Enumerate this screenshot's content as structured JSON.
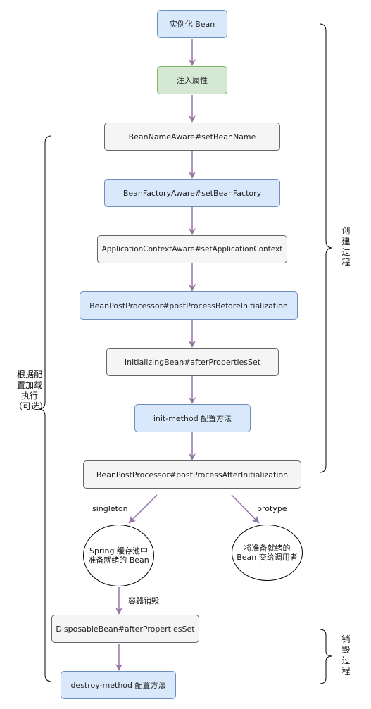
{
  "nodes": {
    "instantiate": "实例化 Bean",
    "inject": "注入属性",
    "bean_name_aware": "BeanNameAware#setBeanName",
    "bean_factory_aware": "BeanFactoryAware#setBeanFactory",
    "app_context_aware": "ApplicationContextAware#setApplicationContext",
    "before_init": "BeanPostProcessor#postProcessBeforeInitialization",
    "initializing_bean": "InitializingBean#afterPropertiesSet",
    "init_method": "init-method 配置方法",
    "after_init": "BeanPostProcessor#postProcessAfterInitialization",
    "singleton_cache": "Spring 缓存池中准备就绪的 Bean",
    "prototype_handoff": "将准备就绪的 Bean 交给调用者",
    "disposable_bean": "DisposableBean#afterPropertiesSet",
    "destroy_method": "destroy-method 配置方法"
  },
  "labels": {
    "singleton": "singleton",
    "prototype": "protype",
    "container_destroy": "容器销毁",
    "create_process": "创建过程",
    "destroy_process": "销毁过程",
    "conditional_exec": "根据配置加载执行（可选）"
  },
  "colors": {
    "blue_fill": "#dae8fc",
    "blue_stroke": "#6c8ebf",
    "green_fill": "#d5e8d4",
    "green_stroke": "#82b366",
    "gray_fill": "#f5f5f5",
    "gray_stroke": "#666666",
    "arrow": "#9673a6"
  }
}
